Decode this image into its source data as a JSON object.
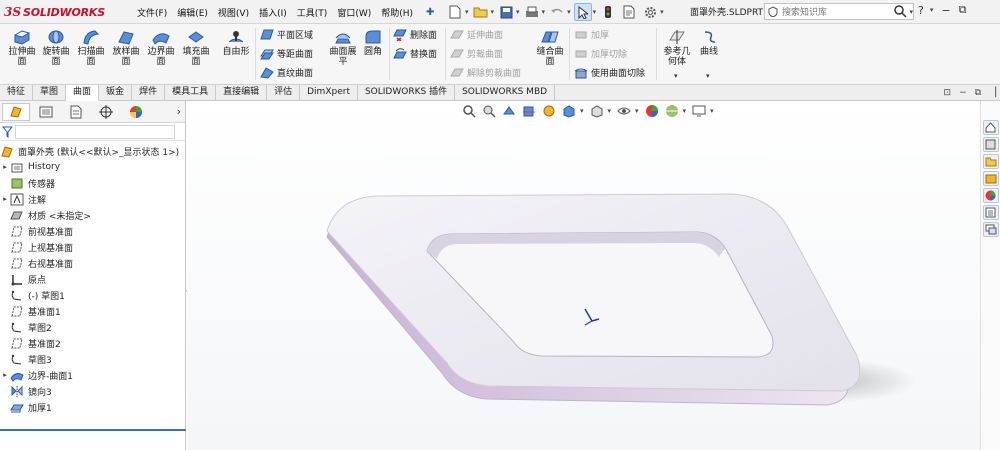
{
  "app": {
    "brand_ds": "3S",
    "brand_name": "SOLIDWORKS"
  },
  "menus": [
    "文件(F)",
    "编辑(E)",
    "视图(V)",
    "插入(I)",
    "工具(T)",
    "窗口(W)",
    "帮助(H)"
  ],
  "document_title": "面罩外壳.SLDPRT",
  "search": {
    "placeholder": "搜索知识库"
  },
  "window_controls": [
    "?",
    "−",
    "⧉"
  ],
  "ribbon": {
    "large_buttons": [
      {
        "l1": "拉伸曲",
        "l2": "面"
      },
      {
        "l1": "旋转曲",
        "l2": "面"
      },
      {
        "l1": "扫描曲",
        "l2": "面"
      },
      {
        "l1": "放样曲",
        "l2": "面"
      },
      {
        "l1": "边界曲",
        "l2": "面"
      },
      {
        "l1": "填充曲",
        "l2": "面"
      },
      {
        "l1": "自由形",
        "l2": ""
      }
    ],
    "group2": [
      "平面区域",
      "等距曲面",
      "直纹曲面"
    ],
    "flatten": {
      "l1": "曲面展",
      "l2": "平"
    },
    "fillet": "圆角",
    "group3": [
      "删除面",
      "替换面"
    ],
    "group4": [
      "延伸曲面",
      "剪裁曲面",
      "解除剪裁曲面"
    ],
    "knit": {
      "l1": "缝合曲",
      "l2": "面"
    },
    "group5": [
      "加厚",
      "加厚切除",
      "使用曲面切除"
    ],
    "refgeom": {
      "l1": "参考几",
      "l2": "何体"
    },
    "curves": "曲线"
  },
  "tabs": [
    "特征",
    "草图",
    "曲面",
    "钣金",
    "焊件",
    "模具工具",
    "直接编辑",
    "评估",
    "DimXpert",
    "SOLIDWORKS 插件",
    "SOLIDWORKS MBD"
  ],
  "active_tab": "曲面",
  "tree": {
    "root": "面罩外壳 (默认<<默认>_显示状态 1>)",
    "items": [
      {
        "label": "History",
        "expandable": true,
        "icon": "history-icon"
      },
      {
        "label": "传感器",
        "expandable": false,
        "icon": "sensor-icon"
      },
      {
        "label": "注解",
        "expandable": true,
        "icon": "annotation-icon"
      },
      {
        "label": "材质 <未指定>",
        "expandable": false,
        "icon": "material-icon"
      },
      {
        "label": "前视基准面",
        "expandable": false,
        "icon": "plane-icon"
      },
      {
        "label": "上视基准面",
        "expandable": false,
        "icon": "plane-icon"
      },
      {
        "label": "右视基准面",
        "expandable": false,
        "icon": "plane-icon"
      },
      {
        "label": "原点",
        "expandable": false,
        "icon": "origin-icon"
      },
      {
        "label": "(-) 草图1",
        "expandable": false,
        "icon": "sketch-icon"
      },
      {
        "label": "基准面1",
        "expandable": false,
        "icon": "plane-icon"
      },
      {
        "label": "草图2",
        "expandable": false,
        "icon": "sketch-icon"
      },
      {
        "label": "基准面2",
        "expandable": false,
        "icon": "plane-icon"
      },
      {
        "label": "草图3",
        "expandable": false,
        "icon": "sketch-icon"
      },
      {
        "label": "边界-曲面1",
        "expandable": true,
        "icon": "boundary-surface-icon"
      },
      {
        "label": "镜向3",
        "expandable": false,
        "icon": "mirror-icon"
      },
      {
        "label": "加厚1",
        "expandable": false,
        "icon": "thicken-icon"
      }
    ]
  },
  "colors": {
    "brand": "#c8102e",
    "accent": "#1f5fa8",
    "model": "#f1f0f5",
    "model_side": "#cdb8d8"
  }
}
